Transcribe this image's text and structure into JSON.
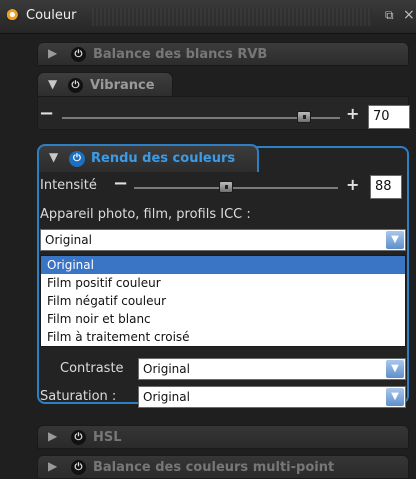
{
  "window": {
    "title": "Couleur",
    "detach_glyph": "⧉",
    "close_glyph": "×",
    "icon": "rawtherapee-logo-icon"
  },
  "sections": {
    "balance_rgb": {
      "label": "Balance des blancs RVB",
      "expanded": false,
      "enabled": false
    },
    "vibrance": {
      "label": "Vibrance",
      "expanded": true,
      "value": "70",
      "minus": "−",
      "plus": "+"
    },
    "rendu": {
      "label": "Rendu des couleurs",
      "expanded": true,
      "intensite_label": "Intensité",
      "intensite_value": "88",
      "minus": "−",
      "plus": "+",
      "profile_label": "Appareil photo, film, profils ICC :",
      "profile_selected": "Original",
      "dropdown_options": [
        "Original",
        "Film positif couleur",
        "Film négatif couleur",
        "Film noir et blanc",
        "Film à traitement croisé"
      ],
      "contraste_label": "Contraste",
      "contraste_value": "Original",
      "saturation_label": "Saturation :",
      "saturation_value": "Original"
    },
    "hsl": {
      "label": "HSL"
    },
    "multipoint": {
      "label": "Balance des couleurs multi-point"
    }
  },
  "glyphs": {
    "collapsed": "▶",
    "expanded": "▼",
    "power": "⏻",
    "dropdown_arrow": "▼"
  },
  "colors": {
    "accent": "#2f7fc5",
    "selection": "#3a74c4"
  }
}
